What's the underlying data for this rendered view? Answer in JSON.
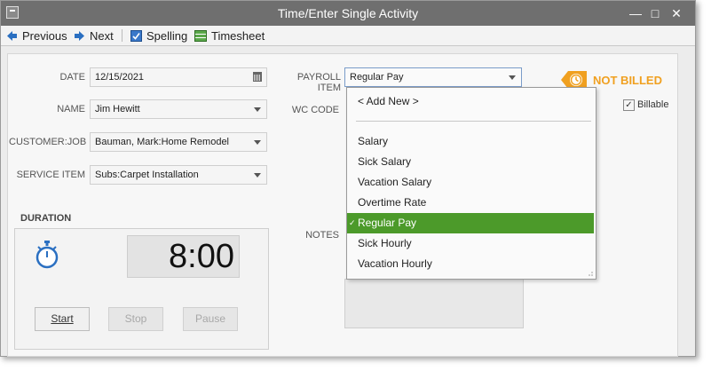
{
  "window": {
    "title": "Time/Enter Single Activity"
  },
  "toolbar": {
    "previous": "Previous",
    "next": "Next",
    "spelling": "Spelling",
    "timesheet": "Timesheet"
  },
  "form": {
    "date_label": "DATE",
    "date_value": "12/15/2021",
    "name_label": "NAME",
    "name_value": "Jim Hewitt",
    "customer_label": "CUSTOMER:JOB",
    "customer_value": "Bauman, Mark:Home Remodel",
    "service_label": "SERVICE ITEM",
    "service_value": "Subs:Carpet Installation",
    "payroll_label": "PAYROLL ITEM",
    "payroll_value": "Regular Pay",
    "wc_label": "WC CODE",
    "notes_label": "NOTES",
    "billed_status": "NOT BILLED",
    "billable_label": "Billable",
    "billable_checked": true
  },
  "duration": {
    "label": "DURATION",
    "time": "8:00",
    "start": "Start",
    "stop": "Stop",
    "pause": "Pause"
  },
  "dropdown": {
    "add_new": "< Add New >",
    "options": [
      "Salary",
      "Sick Salary",
      "Vacation Salary",
      "Overtime Rate",
      "Regular Pay",
      "Sick Hourly",
      "Vacation Hourly"
    ],
    "selected": "Regular Pay",
    "selected_color": "#4c9a2a"
  },
  "colors": {
    "titlebar": "#6f6f6f",
    "billed": "#f0a020",
    "accent_blue": "#2a6fc1"
  }
}
